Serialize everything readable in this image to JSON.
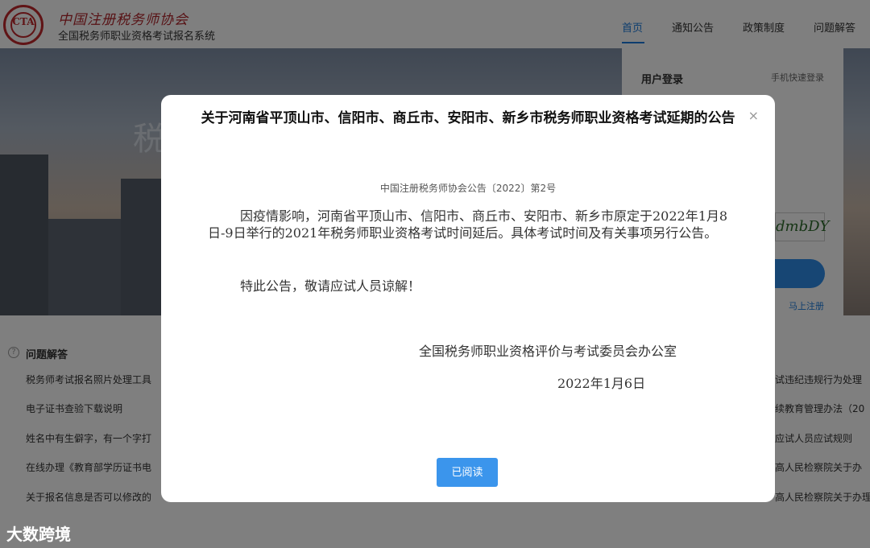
{
  "header": {
    "logo_glyph": "CTA",
    "logo_line1": "中国注册税务师协会",
    "logo_line2": "全国税务师职业资格考试报名系统",
    "nav": [
      "首页",
      "通知公告",
      "政策制度",
      "问题解答"
    ]
  },
  "banner": {
    "title": "税"
  },
  "login": {
    "title": "用户登录",
    "quick": "手机快速登录",
    "captcha": "dmbDY",
    "register": "马上注册"
  },
  "faq": {
    "title": "问题解答",
    "left_items": [
      "税务师考试报名照片处理工具",
      "电子证书查验下载说明",
      "姓名中有生僻字，有一个字打",
      "在线办理《教育部学历证书电",
      "关于报名信息是否可以修改的"
    ],
    "right_items": [
      "试违纪违规行为处理",
      "续教育管理办法（20",
      "应试人员应试规则",
      "高人民检察院关于办",
      "高人民检察院关于办理"
    ]
  },
  "watermark": "大数跨境",
  "modal": {
    "title": "关于河南省平顶山市、信阳市、商丘市、安阳市、新乡市税务师职业资格考试延期的公告",
    "subtitle": "中国注册税务师协会公告〔2022〕第2号",
    "body": "因疫情影响，河南省平顶山市、信阳市、商丘市、安阳市、新乡市原定于2022年1月8日-9日举行的2021年税务师职业资格考试时间延后。具体考试时间及有关事项另行公告。",
    "body2": "特此公告，敬请应试人员谅解！",
    "sign_org": "全国税务师职业资格评价与考试委员会办公室",
    "sign_date": "2022年1月6日",
    "read_button": "已阅读"
  }
}
